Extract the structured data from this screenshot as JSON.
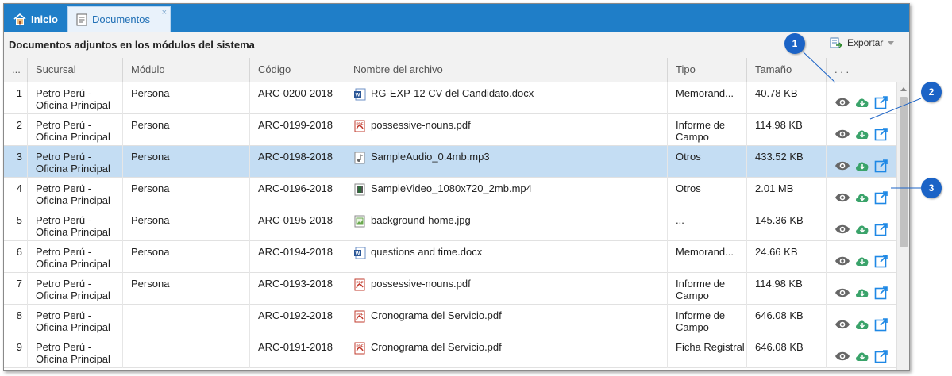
{
  "tabs": {
    "home_label": "Inicio",
    "docs_label": "Documentos",
    "close_glyph": "×"
  },
  "toolbar": {
    "title": "Documentos adjuntos en los módulos del sistema",
    "export_label": "Exportar"
  },
  "columns": {
    "row_num": "...",
    "sucursal": "Sucursal",
    "modulo": "Módulo",
    "codigo": "Código",
    "archivo": "Nombre del archivo",
    "tipo": "Tipo",
    "tamano": "Tamaño",
    "acciones": ". . ."
  },
  "rows": [
    {
      "num": "1",
      "sucursal": "Petro Perú - Oficina Principal",
      "modulo": "Persona",
      "codigo": "ARC-0200-2018",
      "archivo": "RG-EXP-12 CV del Candidato.docx",
      "file_icon": "word-file-icon",
      "tipo": "Memorand...",
      "tamano": "40.78 KB"
    },
    {
      "num": "2",
      "sucursal": "Petro Perú - Oficina Principal",
      "modulo": "Persona",
      "codigo": "ARC-0199-2018",
      "archivo": "possessive-nouns.pdf",
      "file_icon": "pdf-file-icon",
      "tipo": "Informe de Campo",
      "tamano": "114.98 KB"
    },
    {
      "num": "3",
      "sucursal": "Petro Perú - Oficina Principal",
      "modulo": "Persona",
      "codigo": "ARC-0198-2018",
      "archivo": "SampleAudio_0.4mb.mp3",
      "file_icon": "audio-file-icon",
      "tipo": "Otros",
      "tamano": "433.52 KB",
      "selected": true
    },
    {
      "num": "4",
      "sucursal": "Petro Perú - Oficina Principal",
      "modulo": "Persona",
      "codigo": "ARC-0196-2018",
      "archivo": "SampleVideo_1080x720_2mb.mp4",
      "file_icon": "video-file-icon",
      "tipo": "Otros",
      "tamano": "2.01 MB"
    },
    {
      "num": "5",
      "sucursal": "Petro Perú - Oficina Principal",
      "modulo": "Persona",
      "codigo": "ARC-0195-2018",
      "archivo": "background-home.jpg",
      "file_icon": "image-file-icon",
      "tipo": "...",
      "tamano": "145.36 KB"
    },
    {
      "num": "6",
      "sucursal": "Petro Perú - Oficina Principal",
      "modulo": "Persona",
      "codigo": "ARC-0194-2018",
      "archivo": "questions and time.docx",
      "file_icon": "word-file-icon",
      "tipo": "Memorand...",
      "tamano": "24.66 KB"
    },
    {
      "num": "7",
      "sucursal": "Petro Perú - Oficina Principal",
      "modulo": "Persona",
      "codigo": "ARC-0193-2018",
      "archivo": "possessive-nouns.pdf",
      "file_icon": "pdf-file-icon",
      "tipo": "Informe de Campo",
      "tamano": "114.98 KB"
    },
    {
      "num": "8",
      "sucursal": "Petro Perú - Oficina Principal",
      "modulo": "",
      "codigo": "ARC-0192-2018",
      "archivo": "Cronograma del Servicio.pdf",
      "file_icon": "pdf-file-icon",
      "tipo": "Informe de Campo",
      "tamano": "646.08 KB"
    },
    {
      "num": "9",
      "sucursal": "Petro Perú - Oficina Principal",
      "modulo": "",
      "codigo": "ARC-0191-2018",
      "archivo": "Cronograma del Servicio.pdf",
      "file_icon": "pdf-file-icon",
      "tipo": "Ficha Registral",
      "tamano": "646.08 KB"
    }
  ],
  "row_actions": [
    "view-eye-icon",
    "download-cloud-icon",
    "open-external-icon"
  ],
  "callouts": [
    "1",
    "2",
    "3"
  ],
  "colors": {
    "tabbar": "#1f7ec8",
    "selected_row": "#c4ddf3",
    "header_underline": "#c0504d",
    "callout": "#1b63c6",
    "download_green": "#3aa36a",
    "link_blue": "#1e88e5"
  }
}
